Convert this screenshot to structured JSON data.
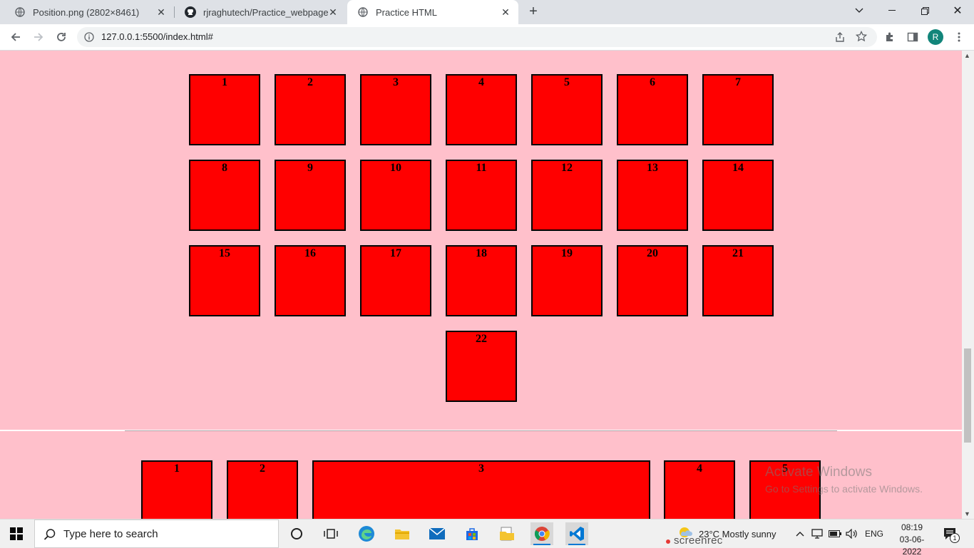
{
  "browser": {
    "tabs": [
      {
        "title": "Position.png (2802×8461)",
        "active": false,
        "icon": "globe-icon"
      },
      {
        "title": "rjraghutech/Practice_webpage",
        "active": false,
        "icon": "github-icon"
      },
      {
        "title": "Practice HTML",
        "active": true,
        "icon": "globe-icon"
      }
    ],
    "url": "127.0.0.1:5500/index.html#",
    "profile_initial": "R"
  },
  "page": {
    "background": "#ffc0cb",
    "box_color": "#ff0000",
    "grid_boxes": [
      "1",
      "2",
      "3",
      "4",
      "5",
      "6",
      "7",
      "8",
      "9",
      "10",
      "11",
      "12",
      "13",
      "14",
      "15",
      "16",
      "17",
      "18",
      "19",
      "20",
      "21",
      "22"
    ],
    "bottom_boxes": [
      "1",
      "2",
      "3",
      "4",
      "5"
    ]
  },
  "watermark": {
    "line1": "Activate Windows",
    "line2": "Go to Settings to activate Windows."
  },
  "taskbar": {
    "search_placeholder": "Type here to search",
    "weather": "23°C  Mostly sunny",
    "language": "ENG",
    "time": "08:19",
    "date": "03-06-2022",
    "recorder": "screenrec",
    "notification_count": "1",
    "accent": "#0078d4"
  }
}
